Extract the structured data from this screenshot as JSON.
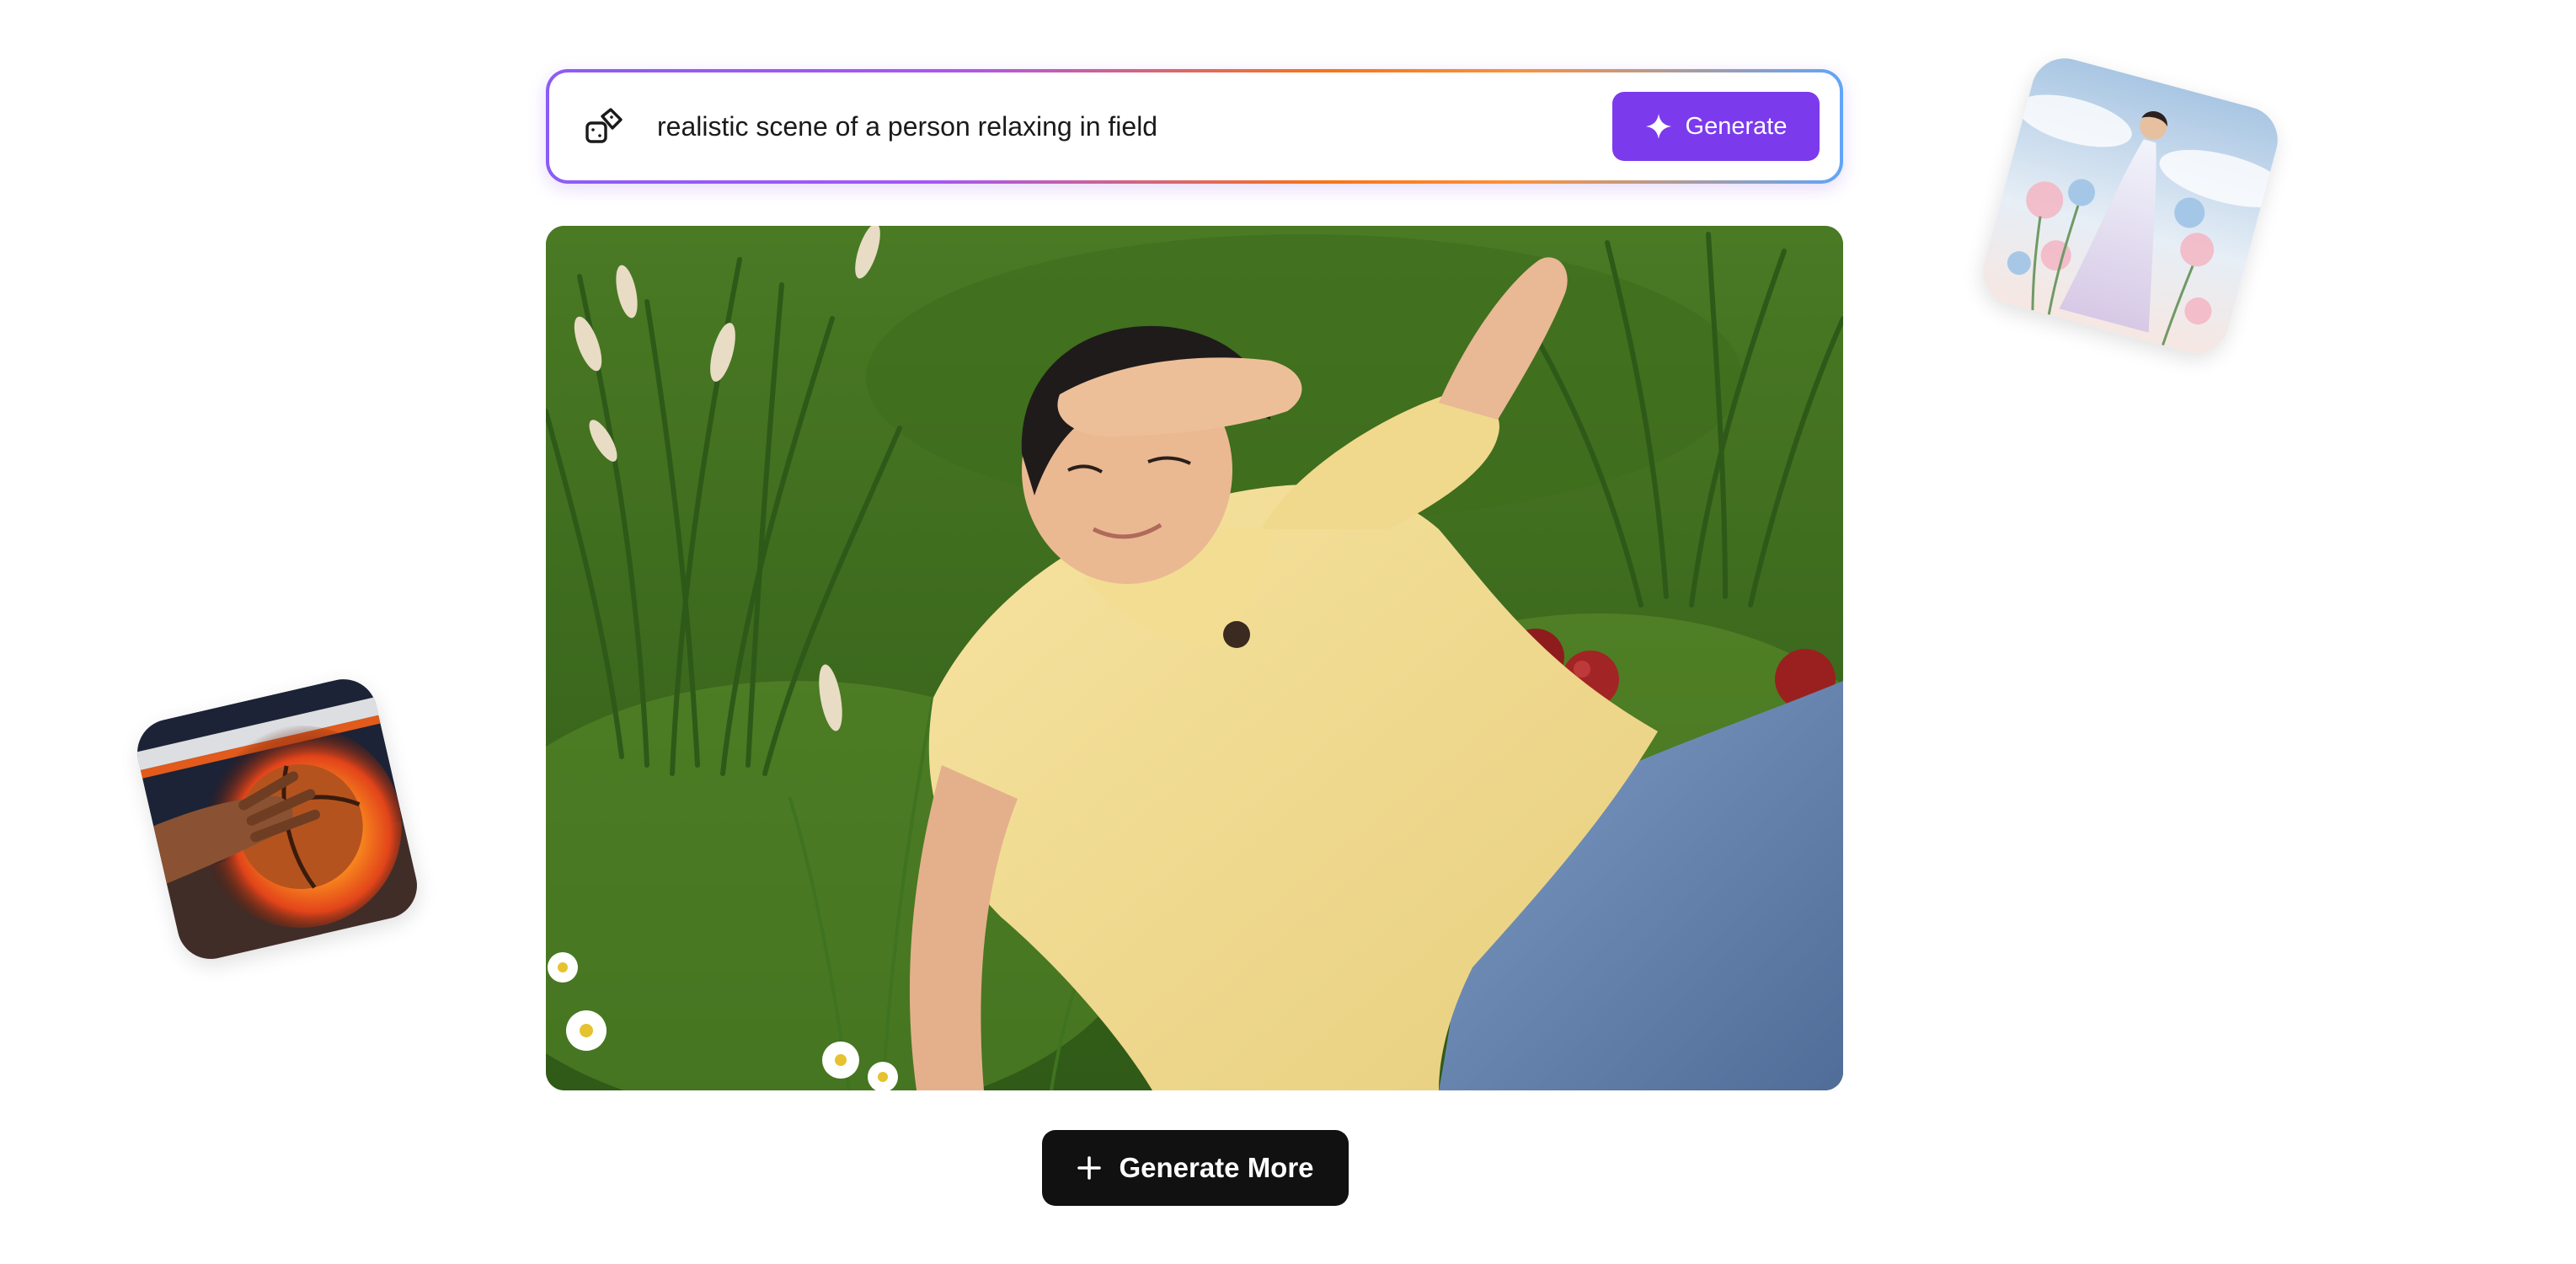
{
  "prompt": {
    "value": "realistic scene of a person relaxing in field",
    "randomize_icon": "dice-icon",
    "generate_label": "Generate",
    "generate_icon": "sparkle-icon"
  },
  "main_image": {
    "alt": "realistic scene of a person relaxing in field"
  },
  "actions": {
    "generate_more_label": "Generate More",
    "generate_more_icon": "plus-icon"
  },
  "thumbnails": [
    {
      "alt": "flaming basketball in hand"
    },
    {
      "alt": "woman in dress among flowers"
    }
  ],
  "colors": {
    "accent": "#7c3aed",
    "dark_button": "#111111",
    "background": "#ffffff"
  }
}
